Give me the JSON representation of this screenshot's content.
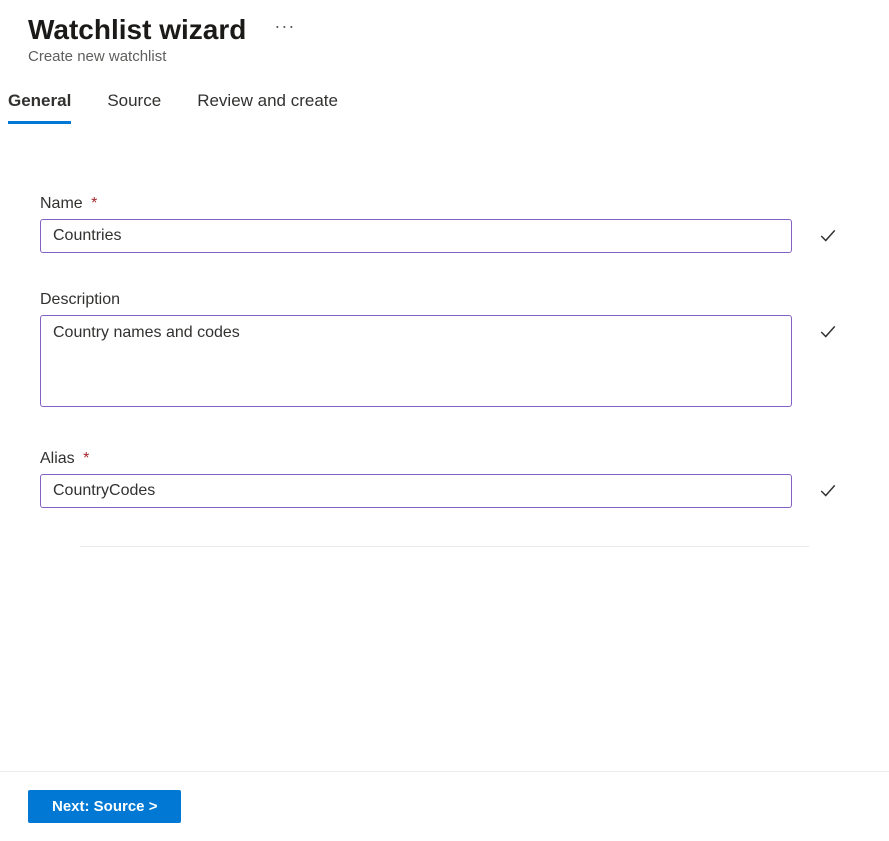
{
  "header": {
    "title": "Watchlist wizard",
    "subtitle": "Create new watchlist"
  },
  "tabs": [
    {
      "label": "General",
      "active": true
    },
    {
      "label": "Source",
      "active": false
    },
    {
      "label": "Review and create",
      "active": false
    }
  ],
  "form": {
    "name": {
      "label": "Name",
      "required_star": "*",
      "value": "Countries"
    },
    "description": {
      "label": "Description",
      "value": "Country names and codes"
    },
    "alias": {
      "label": "Alias",
      "required_star": "*",
      "value": "CountryCodes"
    }
  },
  "footer": {
    "next_label": "Next: Source >"
  }
}
